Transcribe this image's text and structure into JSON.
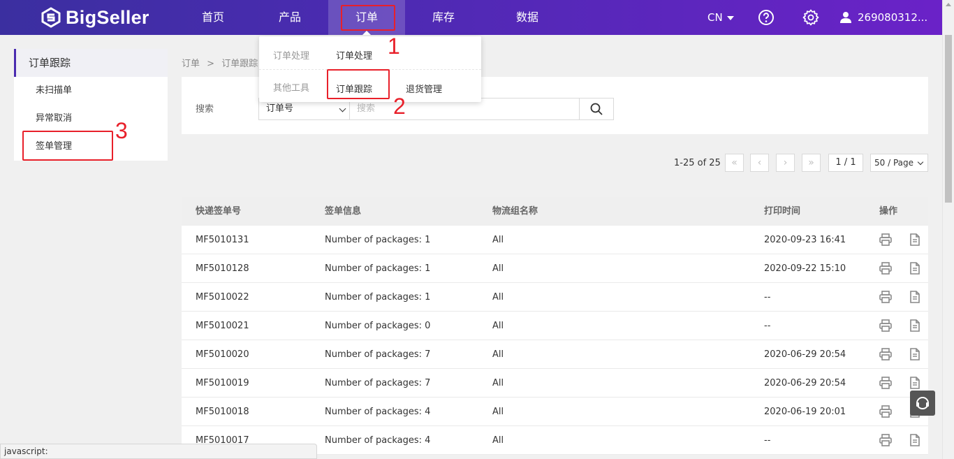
{
  "topbar": {
    "logo_text": "BigSeller",
    "nav": [
      "首页",
      "产品",
      "订单",
      "库存",
      "数据"
    ],
    "active_nav": "订单",
    "lang": "CN",
    "user": "269080312..."
  },
  "dropdown": {
    "rows": [
      {
        "category": "订单处理",
        "links": [
          "订单处理"
        ]
      },
      {
        "category": "其他工具",
        "links": [
          "订单跟踪",
          "退货管理"
        ]
      }
    ]
  },
  "sidebar": {
    "title": "订单跟踪",
    "items": [
      "未扫描单",
      "异常取消",
      "签单管理"
    ]
  },
  "breadcrumb": [
    "订单",
    ">",
    "订单跟踪"
  ],
  "search": {
    "label": "搜索",
    "select_value": "订单号",
    "placeholder": "搜索"
  },
  "pagination": {
    "summary": "1-25 of 25",
    "first": "«",
    "prev": "‹",
    "next": "›",
    "last": "»",
    "page": "1 / 1",
    "page_size": "50 / Page"
  },
  "table": {
    "headers": [
      "快递签单号",
      "签单信息",
      "物流组名称",
      "打印时间",
      "操作"
    ],
    "rows": [
      [
        "MF5010131",
        "Number of packages: 1",
        "All",
        "2020-09-23 16:41"
      ],
      [
        "MF5010128",
        "Number of packages: 1",
        "All",
        "2020-09-22 15:10"
      ],
      [
        "MF5010022",
        "Number of packages: 1",
        "All",
        "--"
      ],
      [
        "MF5010021",
        "Number of packages: 0",
        "All",
        "--"
      ],
      [
        "MF5010020",
        "Number of packages: 7",
        "All",
        "2020-06-29 20:54"
      ],
      [
        "MF5010019",
        "Number of packages: 7",
        "All",
        "2020-06-29 20:54"
      ],
      [
        "MF5010018",
        "Number of packages: 4",
        "All",
        "2020-06-19 20:01"
      ],
      [
        "MF5010017",
        "Number of packages: 4",
        "All",
        "--"
      ]
    ]
  },
  "annotations": [
    "1",
    "2",
    "3"
  ],
  "statusbar": "javascript:",
  "colors": {
    "brand": "#4a2bb0",
    "highlight": "#e8202a"
  }
}
